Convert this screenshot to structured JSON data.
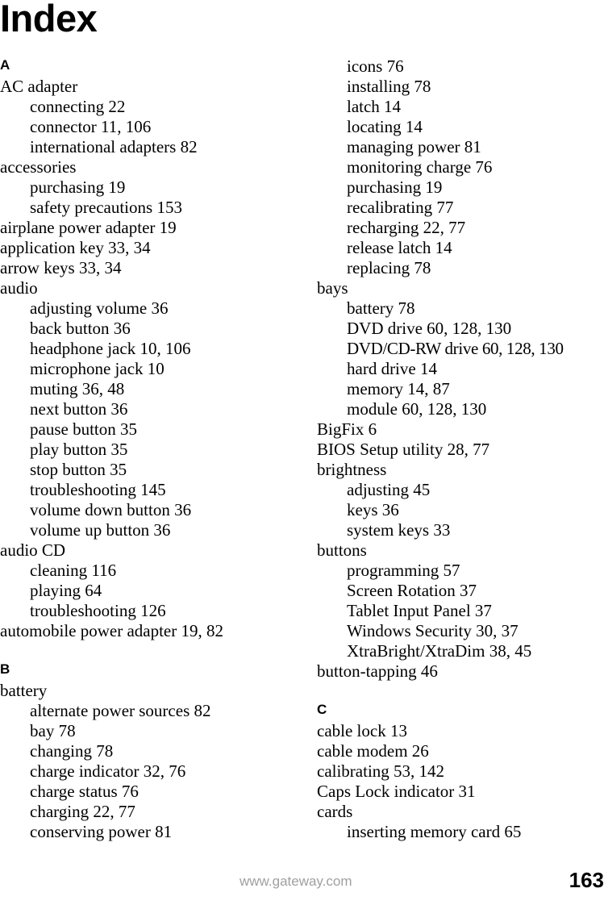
{
  "page_title": "Index",
  "footer": {
    "url": "www.gateway.com",
    "page_number": "163"
  },
  "columns": [
    {
      "name": "left-column",
      "sections": [
        {
          "letter": "A",
          "entries": [
            {
              "level": 1,
              "text": "AC adapter"
            },
            {
              "level": 2,
              "text": "connecting  22"
            },
            {
              "level": 2,
              "text": "connector  11,  106"
            },
            {
              "level": 2,
              "text": "international adapters  82"
            },
            {
              "level": 1,
              "text": "accessories"
            },
            {
              "level": 2,
              "text": "purchasing  19"
            },
            {
              "level": 2,
              "text": "safety precautions  153"
            },
            {
              "level": 1,
              "text": "airplane power adapter  19"
            },
            {
              "level": 1,
              "text": "application key  33,  34"
            },
            {
              "level": 1,
              "text": "arrow keys  33,  34"
            },
            {
              "level": 1,
              "text": "audio"
            },
            {
              "level": 2,
              "text": "adjusting volume  36"
            },
            {
              "level": 2,
              "text": "back button  36"
            },
            {
              "level": 2,
              "text": "headphone jack  10,  106"
            },
            {
              "level": 2,
              "text": "microphone jack  10"
            },
            {
              "level": 2,
              "text": "muting  36,  48"
            },
            {
              "level": 2,
              "text": "next button  36"
            },
            {
              "level": 2,
              "text": "pause button  35"
            },
            {
              "level": 2,
              "text": "play button  35"
            },
            {
              "level": 2,
              "text": "stop button  35"
            },
            {
              "level": 2,
              "text": "troubleshooting  145"
            },
            {
              "level": 2,
              "text": "volume down button  36"
            },
            {
              "level": 2,
              "text": "volume up button  36"
            },
            {
              "level": 1,
              "text": "audio CD"
            },
            {
              "level": 2,
              "text": "cleaning  116"
            },
            {
              "level": 2,
              "text": "playing  64"
            },
            {
              "level": 2,
              "text": "troubleshooting  126"
            },
            {
              "level": 1,
              "text": "automobile power adapter  19,  82"
            }
          ]
        },
        {
          "letter": "B",
          "entries": [
            {
              "level": 1,
              "text": "battery"
            },
            {
              "level": 2,
              "text": "alternate power sources  82"
            },
            {
              "level": 2,
              "text": "bay  78"
            },
            {
              "level": 2,
              "text": "changing  78"
            },
            {
              "level": 2,
              "text": "charge indicator  32,  76"
            },
            {
              "level": 2,
              "text": "charge status  76"
            },
            {
              "level": 2,
              "text": "charging  22,  77"
            },
            {
              "level": 2,
              "text": "conserving power  81"
            }
          ]
        }
      ]
    },
    {
      "name": "right-column",
      "sections": [
        {
          "letter": "",
          "continuation": true,
          "entries": [
            {
              "level": 2,
              "text": "icons  76"
            },
            {
              "level": 2,
              "text": "installing  78"
            },
            {
              "level": 2,
              "text": "latch  14"
            },
            {
              "level": 2,
              "text": "locating  14"
            },
            {
              "level": 2,
              "text": "managing power  81"
            },
            {
              "level": 2,
              "text": "monitoring charge  76"
            },
            {
              "level": 2,
              "text": "purchasing  19"
            },
            {
              "level": 2,
              "text": "recalibrating  77"
            },
            {
              "level": 2,
              "text": "recharging  22,  77"
            },
            {
              "level": 2,
              "text": "release latch  14"
            },
            {
              "level": 2,
              "text": "replacing  78"
            },
            {
              "level": 1,
              "text": "bays"
            },
            {
              "level": 2,
              "text": "battery  78"
            },
            {
              "level": 2,
              "text": "DVD drive  60,  128,  130"
            },
            {
              "level": 2,
              "text": "DVD/CD-RW drive 60, 128, 130",
              "condensed": true
            },
            {
              "level": 2,
              "text": "hard drive  14"
            },
            {
              "level": 2,
              "text": "memory  14,  87"
            },
            {
              "level": 2,
              "text": "module  60,  128,  130"
            },
            {
              "level": 1,
              "text": "BigFix  6"
            },
            {
              "level": 1,
              "text": "BIOS Setup utility  28,  77"
            },
            {
              "level": 1,
              "text": "brightness"
            },
            {
              "level": 2,
              "text": "adjusting  45"
            },
            {
              "level": 2,
              "text": "keys  36"
            },
            {
              "level": 2,
              "text": "system keys  33"
            },
            {
              "level": 1,
              "text": "buttons"
            },
            {
              "level": 2,
              "text": "programming  57"
            },
            {
              "level": 2,
              "text": "Screen Rotation  37"
            },
            {
              "level": 2,
              "text": "Tablet Input Panel  37"
            },
            {
              "level": 2,
              "text": "Windows Security  30,  37"
            },
            {
              "level": 2,
              "text": "XtraBright/XtraDim  38,  45"
            },
            {
              "level": 1,
              "text": "button-tapping  46"
            }
          ]
        },
        {
          "letter": "C",
          "entries": [
            {
              "level": 1,
              "text": "cable lock  13"
            },
            {
              "level": 1,
              "text": "cable modem  26"
            },
            {
              "level": 1,
              "text": "calibrating  53,  142"
            },
            {
              "level": 1,
              "text": "Caps Lock indicator  31"
            },
            {
              "level": 1,
              "text": "cards"
            },
            {
              "level": 2,
              "text": "inserting memory card  65"
            }
          ]
        }
      ]
    }
  ]
}
